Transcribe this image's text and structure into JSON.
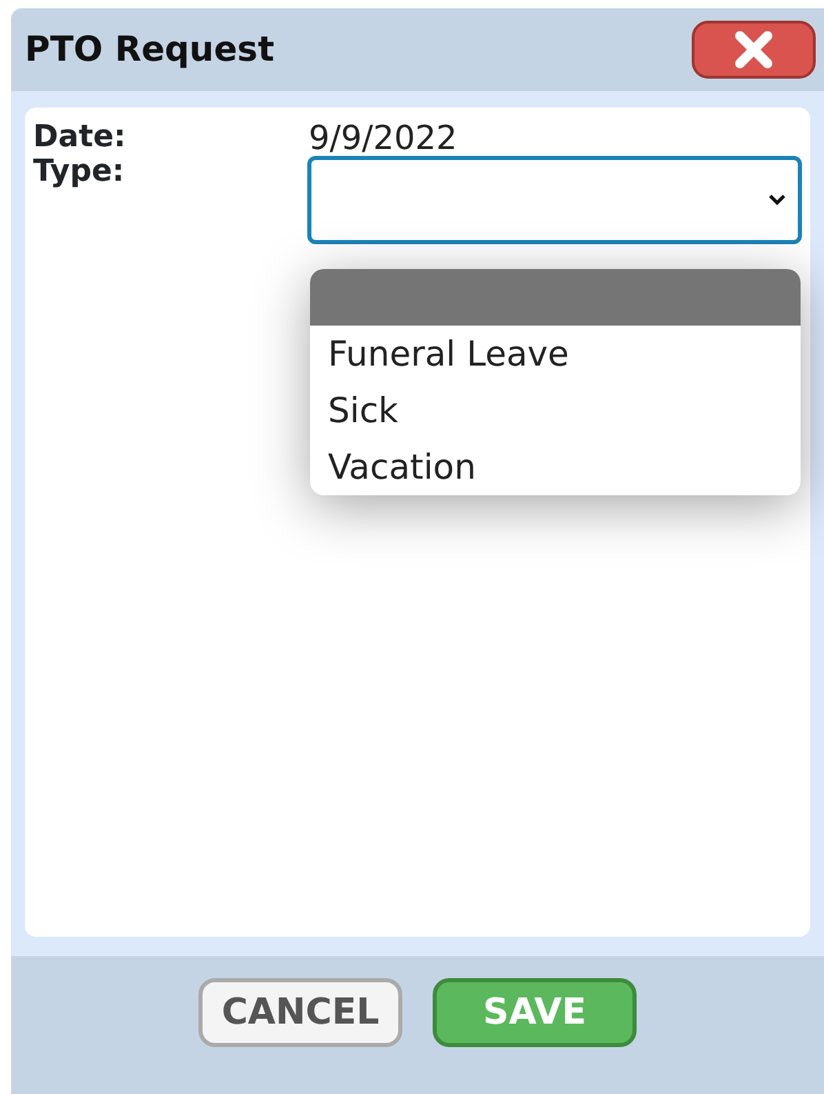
{
  "window": {
    "title": "PTO Request"
  },
  "fields": [
    {
      "label": "Date:",
      "kind": "text",
      "value": "9/9/2022"
    },
    {
      "label": "Type:",
      "kind": "select",
      "expanded": true,
      "options": [
        {
          "selected": true
        },
        {
          "label": "Funeral Leave",
          "selected": false
        },
        {
          "label": "Sick",
          "selected": false
        },
        {
          "label": "Vacation",
          "selected": false
        }
      ]
    }
  ],
  "buttons": [
    {
      "label": "CANCEL",
      "kind": "secondary"
    },
    {
      "label": "SAVE",
      "kind": "primary"
    }
  ]
}
